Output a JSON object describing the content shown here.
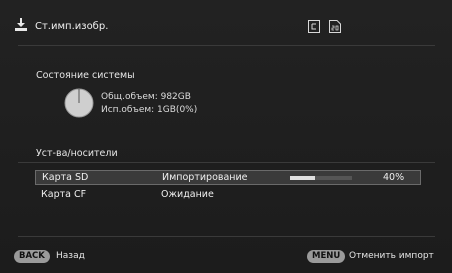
{
  "header": {
    "title": "Ст.имп.изобр.",
    "app_icon": "import-download-icon",
    "media_icons": [
      "cf-card-icon",
      "sd-card-icon"
    ]
  },
  "system_status": {
    "title": "Состояние системы",
    "total_label": "Общ.объем: 982GB",
    "used_label": "Исп.объем: 1GB(0%)",
    "used_fraction": 0.0
  },
  "devices": {
    "title": "Уст-ва/носители",
    "rows": [
      {
        "name": "Карта SD",
        "status": "Импортирование",
        "progress": 40,
        "percent_label": "40%",
        "selected": true
      },
      {
        "name": "Карта CF",
        "status": "Ожидание",
        "selected": false
      }
    ]
  },
  "footer": {
    "back_key": "BACK",
    "back_label": "Назад",
    "menu_key": "MENU",
    "menu_label": "Отменить импорт"
  },
  "colors": {
    "background": "#1b1b1b",
    "text": "#e8e8e8",
    "key_bg": "#9a9a9a",
    "selection": "#3a3a3a"
  }
}
